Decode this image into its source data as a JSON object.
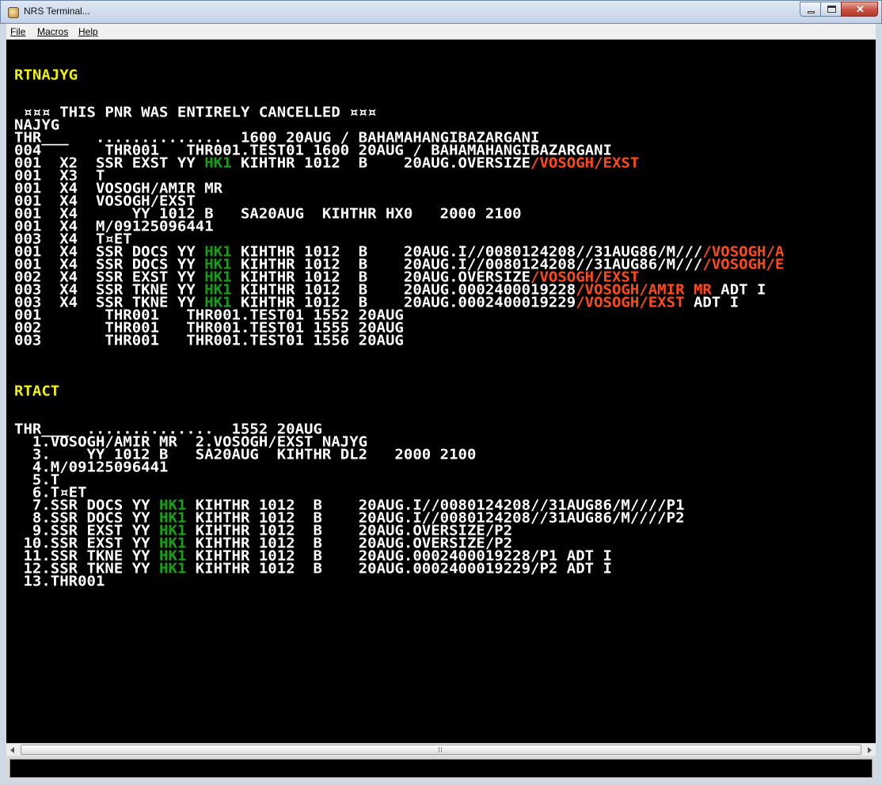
{
  "window": {
    "title": "NRS Terminal...",
    "close_glyph": "✕"
  },
  "menu": {
    "file": "File",
    "macros": "Macros",
    "help": "Help"
  },
  "terminal": {
    "lines": [
      [
        {
          "t": "RTNAJYG",
          "c": "yellow"
        }
      ],
      [
        {
          "t": " ¤¤¤ THIS PNR WAS ENTIRELY CANCELLED ¤¤¤"
        }
      ],
      [
        {
          "t": "NAJYG"
        }
      ],
      [
        {
          "t": "THR___   ..............  1600 20AUG / BAHAMAHANGIBAZARGANI"
        }
      ],
      [
        {
          "t": "004       THR001   THR001.TEST01 1600 20AUG / BAHAMAHANGIBAZARGANI"
        }
      ],
      [
        {
          "t": "001  X2  SSR EXST YY "
        },
        {
          "t": "HK1",
          "c": "green"
        },
        {
          "t": " KIHTHR 1012  B    20AUG.OVERSIZE"
        },
        {
          "t": "/VOSOGH/EXST",
          "c": "red"
        }
      ],
      [
        {
          "t": "001  X3  T"
        }
      ],
      [
        {
          "t": "001  X4  VOSOGH/AMIR MR"
        }
      ],
      [
        {
          "t": "001  X4  VOSOGH/EXST"
        }
      ],
      [
        {
          "t": "001  X4      YY 1012 B   SA20AUG  KIHTHR HX0   2000 2100"
        }
      ],
      [
        {
          "t": "001  X4  M/09125096441"
        }
      ],
      [
        {
          "t": "003  X4  T¤ET"
        }
      ],
      [
        {
          "t": "001  X4  SSR DOCS YY "
        },
        {
          "t": "HK1",
          "c": "green"
        },
        {
          "t": " KIHTHR 1012  B    20AUG.I//0080124208//31AUG86/M///"
        },
        {
          "t": "/VOSOGH/A",
          "c": "red"
        }
      ],
      [
        {
          "t": "001  X4  SSR DOCS YY "
        },
        {
          "t": "HK1",
          "c": "green"
        },
        {
          "t": " KIHTHR 1012  B    20AUG.I//0080124208//31AUG86/M///"
        },
        {
          "t": "/VOSOGH/E",
          "c": "red"
        }
      ],
      [
        {
          "t": "002  X4  SSR EXST YY "
        },
        {
          "t": "HK1",
          "c": "green"
        },
        {
          "t": " KIHTHR 1012  B    20AUG.OVERSIZE"
        },
        {
          "t": "/VOSOGH/EXST",
          "c": "red"
        }
      ],
      [
        {
          "t": "003  X4  SSR TKNE YY "
        },
        {
          "t": "HK1",
          "c": "green"
        },
        {
          "t": " KIHTHR 1012  B    20AUG.0002400019228"
        },
        {
          "t": "/VOSOGH/AMIR MR",
          "c": "red"
        },
        {
          "t": " ADT I"
        }
      ],
      [
        {
          "t": "003  X4  SSR TKNE YY "
        },
        {
          "t": "HK1",
          "c": "green"
        },
        {
          "t": " KIHTHR 1012  B    20AUG.0002400019229"
        },
        {
          "t": "/VOSOGH/EXST",
          "c": "red"
        },
        {
          "t": " ADT I"
        }
      ],
      [
        {
          "t": "001       THR001   THR001.TEST01 1552 20AUG"
        }
      ],
      [
        {
          "t": "002       THR001   THR001.TEST01 1555 20AUG"
        }
      ],
      [
        {
          "t": "003       THR001   THR001.TEST01 1556 20AUG"
        }
      ],
      [
        {
          "t": "RTACT",
          "c": "yellow"
        }
      ],
      [
        {
          "t": "THR___  ..............  1552 20AUG"
        }
      ],
      [
        {
          "t": "  1.VOSOGH/AMIR MR  2.VOSOGH/EXST NAJYG"
        }
      ],
      [
        {
          "t": "  3.    YY 1012 B   SA20AUG  KIHTHR DL2   2000 2100"
        }
      ],
      [
        {
          "t": "  4.M/09125096441"
        }
      ],
      [
        {
          "t": "  5.T"
        }
      ],
      [
        {
          "t": "  6.T¤ET"
        }
      ],
      [
        {
          "t": "  7.SSR DOCS YY "
        },
        {
          "t": "HK1",
          "c": "green"
        },
        {
          "t": " KIHTHR 1012  B    20AUG.I//0080124208//31AUG86/M////P1"
        }
      ],
      [
        {
          "t": "  8.SSR DOCS YY "
        },
        {
          "t": "HK1",
          "c": "green"
        },
        {
          "t": " KIHTHR 1012  B    20AUG.I//0080124208//31AUG86/M////P2"
        }
      ],
      [
        {
          "t": "  9.SSR EXST YY "
        },
        {
          "t": "HK1",
          "c": "green"
        },
        {
          "t": " KIHTHR 1012  B    20AUG.OVERSIZE/P2"
        }
      ],
      [
        {
          "t": " 10.SSR EXST YY "
        },
        {
          "t": "HK1",
          "c": "green"
        },
        {
          "t": " KIHTHR 1012  B    20AUG.OVERSIZE/P2"
        }
      ],
      [
        {
          "t": " 11.SSR TKNE YY "
        },
        {
          "t": "HK1",
          "c": "green"
        },
        {
          "t": " KIHTHR 1012  B    20AUG.0002400019228/P1 ADT I"
        }
      ],
      [
        {
          "t": " 12.SSR TKNE YY "
        },
        {
          "t": "HK1",
          "c": "green"
        },
        {
          "t": " KIHTHR 1012  B    20AUG.0002400019229/P2 ADT I"
        }
      ],
      [
        {
          "t": " 13.THR001"
        }
      ]
    ]
  },
  "command_input": {
    "value": ""
  }
}
